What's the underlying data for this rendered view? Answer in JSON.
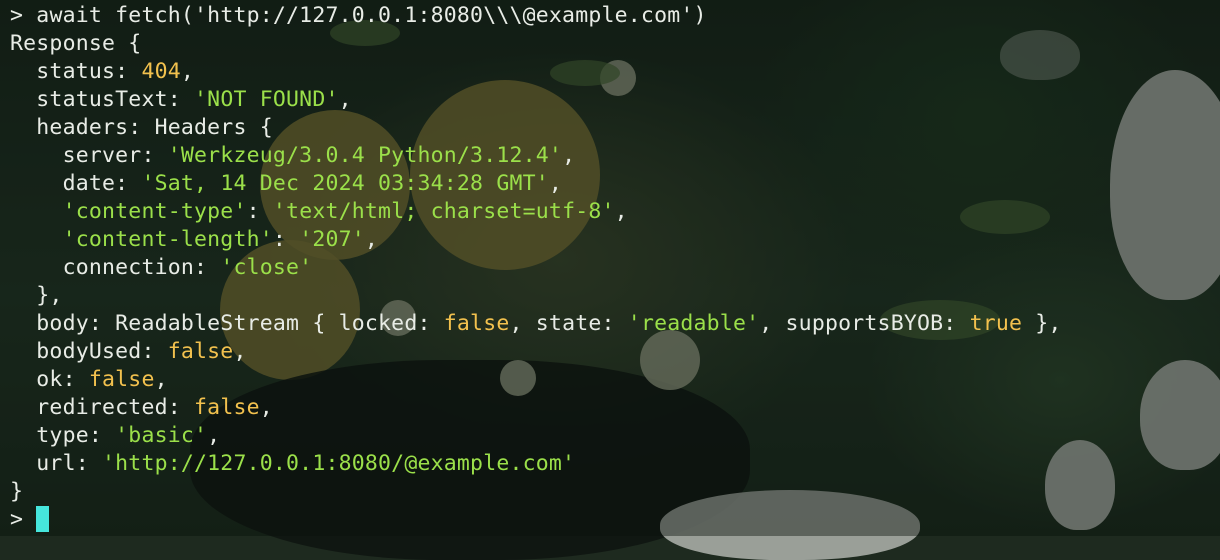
{
  "terminal": {
    "command_line": {
      "prompt": "> ",
      "command": "await fetch('http://127.0.0.1:8080\\\\\\@example.com')"
    },
    "response": {
      "open": "Response {",
      "status_key": "  status: ",
      "status_value": "404",
      "statusText_key": "  statusText: ",
      "statusText_value": "'NOT FOUND'",
      "headers_key": "  headers: Headers {",
      "headers": [
        {
          "key": "    server: ",
          "value": "'Werkzeug/3.0.4 Python/3.12.4'"
        },
        {
          "key": "    date: ",
          "value": "'Sat, 14 Dec 2024 03:34:28 GMT'"
        },
        {
          "key": "    ",
          "key_str": "'content-type'",
          "sep": ": ",
          "value": "'text/html; charset=utf-8'"
        },
        {
          "key": "    ",
          "key_str": "'content-length'",
          "sep": ": ",
          "value": "'207'"
        },
        {
          "key": "    connection: ",
          "value": "'close'"
        }
      ],
      "headers_close": "  },",
      "body_key": "  body: ReadableStream { locked: ",
      "body_locked": "false",
      "body_state_key": ", state: ",
      "body_state": "'readable'",
      "body_byob_key": ", supportsBYOB: ",
      "body_byob": "true",
      "body_close": " },",
      "bodyUsed_key": "  bodyUsed: ",
      "bodyUsed_value": "false",
      "ok_key": "  ok: ",
      "ok_value": "false",
      "redirected_key": "  redirected: ",
      "redirected_value": "false",
      "type_key": "  type: ",
      "type_value": "'basic'",
      "url_key": "  url: ",
      "url_value": "'http://127.0.0.1:8080/@example.com'",
      "close": "}"
    },
    "input_prompt": "> "
  },
  "colors": {
    "text": "#e8ece6",
    "number_bool": "#f2c14e",
    "string": "#9be04a",
    "cursor": "#46e6dc"
  }
}
